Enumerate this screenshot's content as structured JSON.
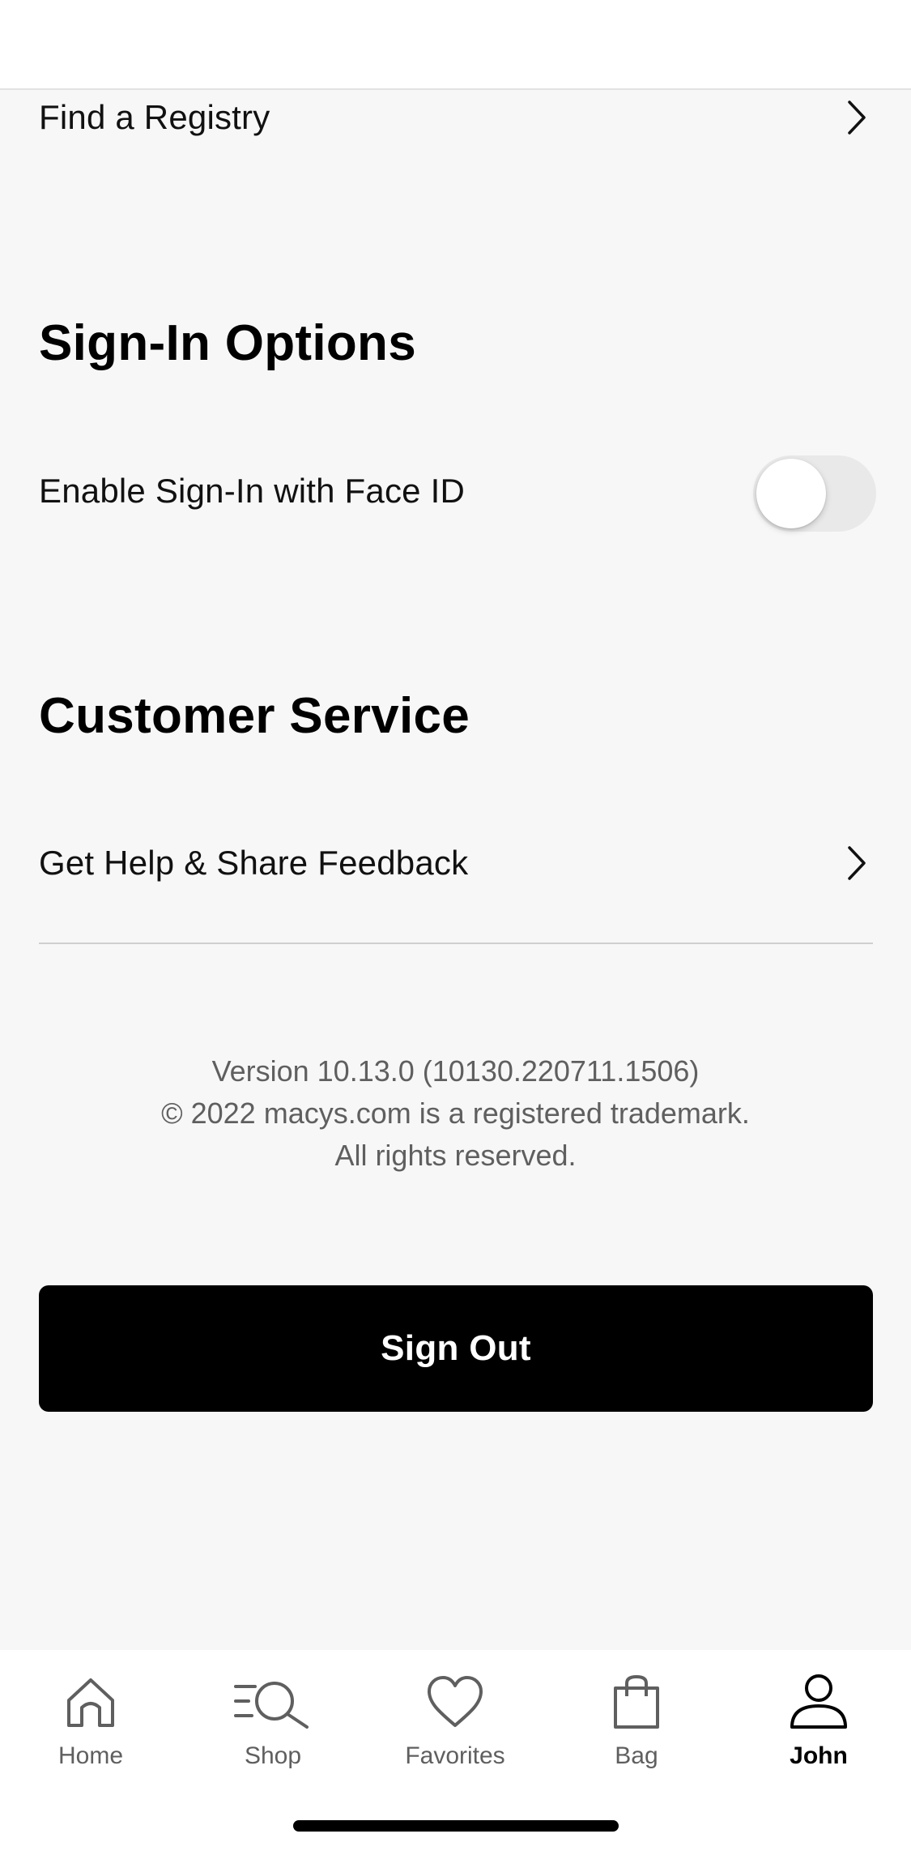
{
  "registry": {
    "label": "Find a Registry"
  },
  "sign_in_options": {
    "title": "Sign-In Options",
    "face_id_label": "Enable Sign-In with Face ID",
    "face_id_enabled": false
  },
  "customer_service": {
    "title": "Customer Service",
    "help_label": "Get Help & Share Feedback"
  },
  "version_info": {
    "line1": "Version 10.13.0 (10130.220711.1506)",
    "line2": "© 2022 macys.com is a registered trademark.",
    "line3": "All rights reserved."
  },
  "sign_out": {
    "label": "Sign Out"
  },
  "tabbar": {
    "active": "John",
    "items": [
      {
        "label": "Home",
        "icon": "home-icon"
      },
      {
        "label": "Shop",
        "icon": "shop-search-icon"
      },
      {
        "label": "Favorites",
        "icon": "heart-icon"
      },
      {
        "label": "Bag",
        "icon": "bag-icon"
      },
      {
        "label": "John",
        "icon": "person-icon"
      }
    ]
  }
}
